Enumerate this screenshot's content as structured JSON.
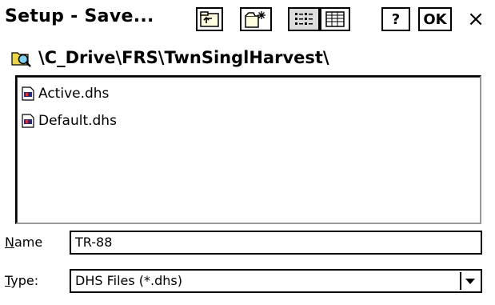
{
  "window": {
    "title": "Setup - Save...",
    "toolbar": {
      "up_folder_icon": "up-folder-icon",
      "new_folder_icon": "new-folder-icon",
      "list_view_icon": "list-view-icon",
      "details_view_icon": "details-view-icon",
      "help_label": "?",
      "ok_label": "OK",
      "close_label": "×"
    }
  },
  "path": {
    "icon": "folder-search-icon",
    "text": "\\C_Drive\\FRS\\TwnSinglHarvest\\"
  },
  "files": [
    {
      "name": "Active.dhs",
      "icon": "dhs-file-icon"
    },
    {
      "name": "Default.dhs",
      "icon": "dhs-file-icon"
    }
  ],
  "form": {
    "name_label_ul": "N",
    "name_label_rest": "ame",
    "name_value": "TR-88",
    "type_label_ul": "T",
    "type_label_rest": "ype:",
    "type_value": "DHS Files (*.dhs)"
  }
}
